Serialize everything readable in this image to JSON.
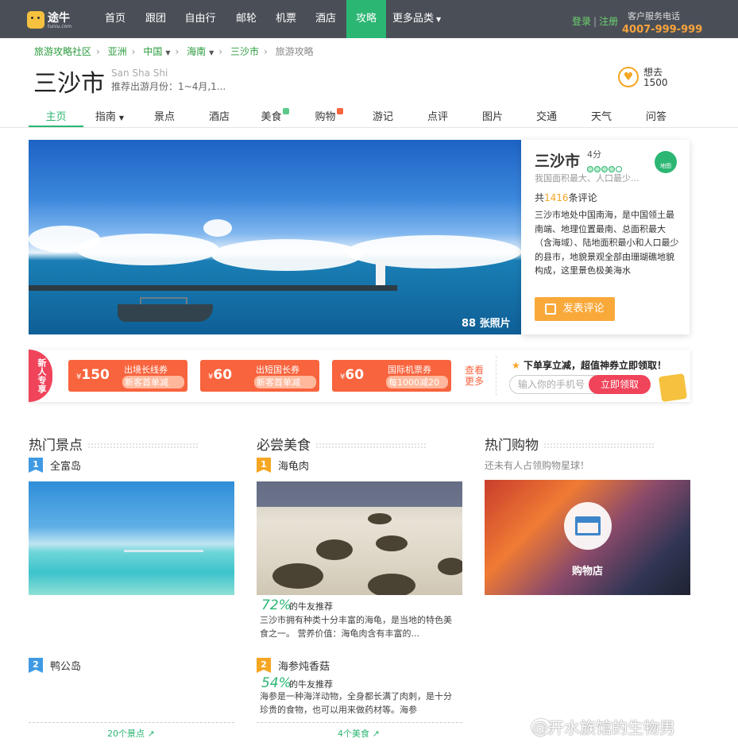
{
  "topbar": {
    "logo_name": "途牛",
    "logo_domain": "tuniu.com",
    "nav": [
      "首页",
      "跟团",
      "自由行",
      "邮轮",
      "机票",
      "酒店",
      "攻略",
      "更多品类"
    ],
    "active_nav": "攻略",
    "login": "登录",
    "register": "注册",
    "service_label": "客户服务电话",
    "phone": "4007-999-999"
  },
  "breadcrumb": [
    "旅游攻略社区",
    "亚洲",
    "中国",
    "海南",
    "三沙市",
    "旅游攻略"
  ],
  "city": {
    "name": "三沙市",
    "pinyin": "San Sha Shi",
    "season": "推荐出游月份：1~4月,1...",
    "want_label": "想去",
    "want_count": "1500"
  },
  "subnav": [
    "主页",
    "指南",
    "景点",
    "酒店",
    "美食",
    "购物",
    "游记",
    "点评",
    "图片",
    "交通",
    "天气",
    "问答"
  ],
  "hero": {
    "photo_count": "88",
    "photo_label": "张照片"
  },
  "info": {
    "name": "三沙市",
    "score": "4分",
    "map_label": "地图",
    "tagline": "我国面积最大、人口最少...",
    "reviews_prefix": "共",
    "reviews_count": "1416",
    "reviews_suffix": "条评论",
    "description": "三沙市地处中国南海，是中国领土最南端、地理位置最南、总面积最大（含海域）、陆地面积最小和人口最少的县市，地貌景观全部由珊瑚礁地貌构成，这里景色极美海水",
    "review_button": "发表评论"
  },
  "promo": {
    "new_tag": "新人专享",
    "coupons": [
      {
        "amount": "150",
        "currency": "¥",
        "title": "出境长线券",
        "condition": "新客首单减"
      },
      {
        "amount": "60",
        "currency": "¥",
        "title": "出短国长券",
        "condition": "新客首单减"
      },
      {
        "amount": "60",
        "currency": "¥",
        "title": "国际机票券",
        "condition": "每1000减20"
      }
    ],
    "more": "查看更多",
    "headline": "下单享立减，超值神券立即领取！",
    "phone_placeholder": "输入你的手机号",
    "claim_button": "立即领取"
  },
  "sections": {
    "spots": {
      "title": "热门景点",
      "items": [
        {
          "rank": "1",
          "name": "全富岛"
        },
        {
          "rank": "2",
          "name": "鸭公岛"
        }
      ],
      "more": "20个景点"
    },
    "food": {
      "title": "必尝美食",
      "items": [
        {
          "rank": "1",
          "name": "海龟肉",
          "pct": "72%",
          "pct_label": "的牛友推荐",
          "desc": "三沙市拥有种类十分丰富的海龟，是当地的特色美食之一。 营养价值：海龟肉含有丰富的..."
        },
        {
          "rank": "2",
          "name": "海参炖香菇",
          "pct": "54%",
          "pct_label": "的牛友推荐",
          "desc": "海参是一种海洋动物，全身都长满了肉刺，是十分珍贵的食物，也可以用来做药材等。海参"
        }
      ],
      "more": "4个美食"
    },
    "shopping": {
      "title": "热门购物",
      "subtitle": "还未有人占领购物星球！",
      "store_label": "购物店"
    }
  },
  "watermark": "@开水族馆的生物男",
  "colors": {
    "brand_green": "#2bb673",
    "orange": "#f5a623",
    "coupon": "#f8643e",
    "red": "#f0445b",
    "topbar": "#4a4f57"
  }
}
